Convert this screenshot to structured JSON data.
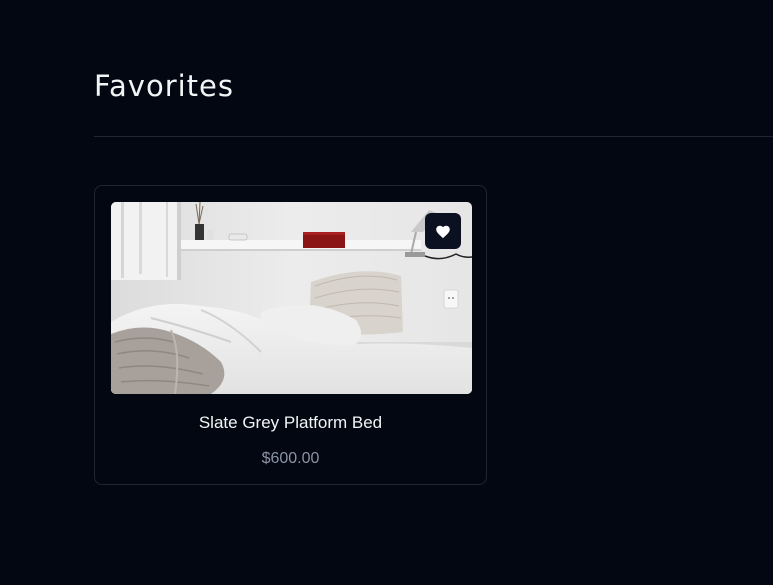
{
  "page": {
    "title": "Favorites"
  },
  "favorites": [
    {
      "name": "Slate Grey Platform Bed",
      "price": "$600.00",
      "image": "bedroom-photo",
      "favorite_icon": "heart-icon"
    }
  ],
  "colors": {
    "background": "#030712",
    "card_border": "#1f2533",
    "title_text": "#f3f4f6",
    "price_text": "#8a94a6",
    "fav_button_bg": "#0b1120"
  }
}
